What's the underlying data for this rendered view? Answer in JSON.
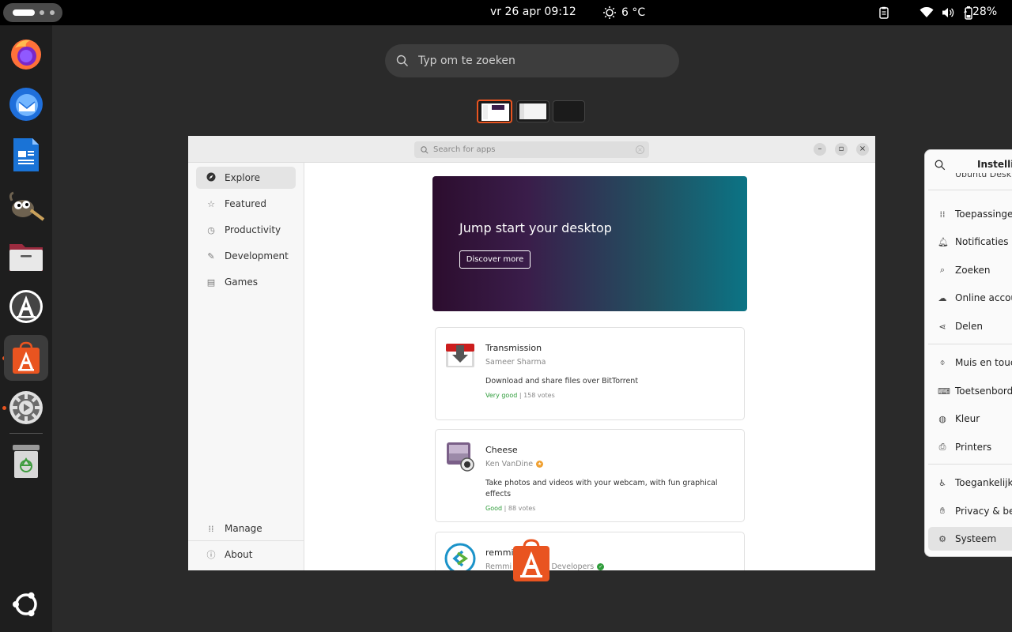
{
  "topbar": {
    "clock": "vr 26 apr  09:12",
    "weather": "6 °C",
    "battery": "28%"
  },
  "overview": {
    "search_placeholder": "Typ om te zoeken"
  },
  "app_center": {
    "search_placeholder": "Search for apps",
    "nav": [
      {
        "label": "Explore",
        "icon": "compass-icon"
      },
      {
        "label": "Featured",
        "icon": "star-icon"
      },
      {
        "label": "Productivity",
        "icon": "clock-icon"
      },
      {
        "label": "Development",
        "icon": "wrench-icon"
      },
      {
        "label": "Games",
        "icon": "gamepad-icon"
      }
    ],
    "bottom_nav": [
      {
        "label": "Manage",
        "icon": "grid-icon"
      },
      {
        "label": "About",
        "icon": "help-icon"
      }
    ],
    "banner": {
      "title": "Jump start your desktop",
      "button": "Discover more"
    },
    "apps": [
      {
        "name": "Transmission",
        "publisher": "Sameer Sharma",
        "description": "Download and share files over BitTorrent",
        "rating": "Very good",
        "votes": "| 158 votes"
      },
      {
        "name": "Cheese",
        "publisher": "Ken VanDine",
        "description": "Take photos and videos with your webcam, with fun graphical effects",
        "rating": "Good",
        "votes": "| 88 votes"
      },
      {
        "name": "remmi",
        "publisher": "Remmi",
        "publisher_suffix": "m Developers"
      }
    ]
  },
  "settings": {
    "title": "Instellin",
    "partial_top": "Ubuntu Deskt",
    "items": [
      {
        "label": "Toepassingen",
        "icon": "grid-icon"
      },
      {
        "label": "Notificaties",
        "icon": "bell-icon"
      },
      {
        "label": "Zoeken",
        "icon": "search-icon"
      },
      {
        "label": "Online accou",
        "icon": "cloud-icon"
      },
      {
        "label": "Delen",
        "icon": "share-icon"
      },
      {
        "label": "Muis en touch",
        "icon": "mouse-icon"
      },
      {
        "label": "Toetsenbord",
        "icon": "keyboard-icon"
      },
      {
        "label": "Kleur",
        "icon": "palette-icon"
      },
      {
        "label": "Printers",
        "icon": "printer-icon"
      },
      {
        "label": "Toegankelijkh",
        "icon": "accessibility-icon"
      },
      {
        "label": "Privacy & bev",
        "icon": "hand-icon"
      },
      {
        "label": "Systeem",
        "icon": "gear-icon"
      }
    ]
  },
  "colors": {
    "accent": "#e95420",
    "good": "#2e9c3a"
  }
}
